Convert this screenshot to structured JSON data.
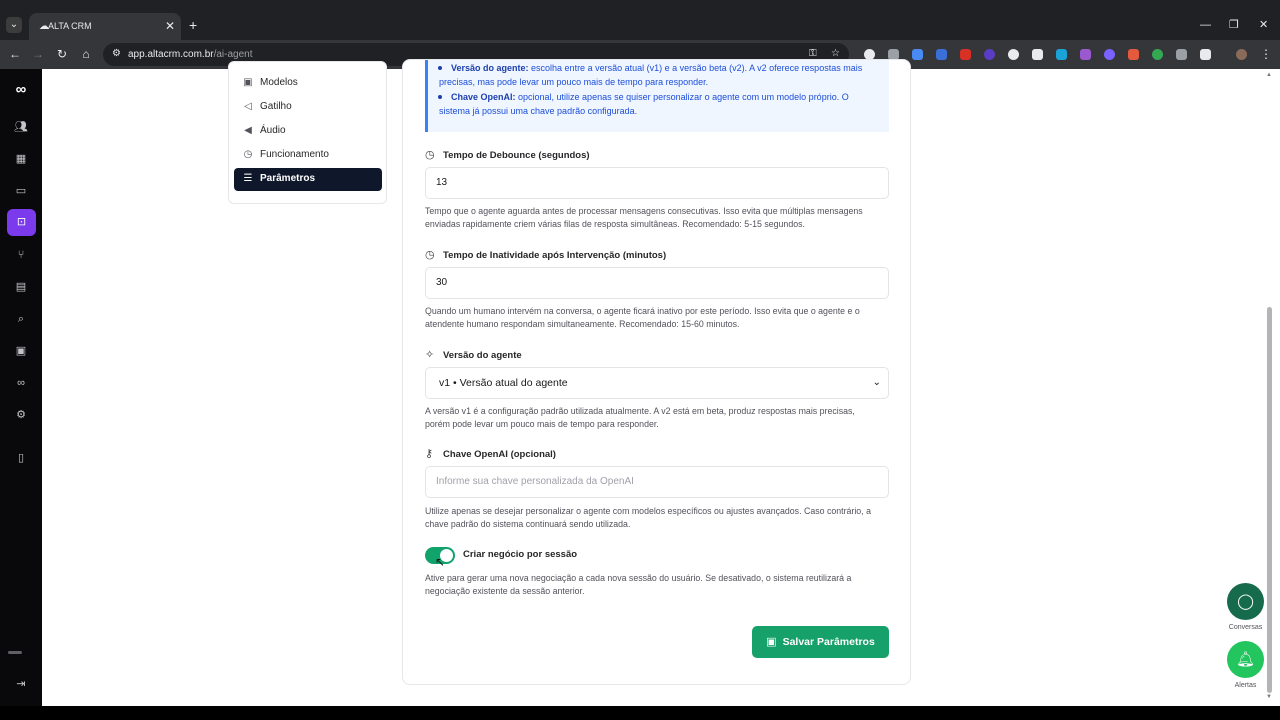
{
  "browser": {
    "tab_title": "ALTA CRM",
    "tab_close": "✕",
    "new_tab": "+",
    "url_host": "app.altacrm.com.br",
    "url_path": "/ai-agent",
    "window_min": "—",
    "window_max": "❐",
    "window_close": "✕"
  },
  "subnav": {
    "items": [
      {
        "label": "Modelos",
        "icon": "cube-icon"
      },
      {
        "label": "Gatilho",
        "icon": "megaphone-icon"
      },
      {
        "label": "Áudio",
        "icon": "speaker-icon"
      },
      {
        "label": "Funcionamento",
        "icon": "clock-icon"
      },
      {
        "label": "Parâmetros",
        "icon": "sliders-icon",
        "active": true
      }
    ]
  },
  "info": {
    "line1_bold": "Versão do agente:",
    "line1_rest": " escolha entre a versão atual (v1) e a versão beta (v2). A v2 oferece respostas mais",
    "line2": "precisas, mas pode levar um pouco mais de tempo para responder.",
    "line3_bold": "Chave OpenAI:",
    "line3_rest": " opcional, utilize apenas se quiser personalizar o agente com um modelo próprio. O",
    "line4": "sistema já possui uma chave padrão configurada."
  },
  "fields": {
    "debounce": {
      "label": "Tempo de Debounce (segundos)",
      "value": "13",
      "help1": "Tempo que o agente aguarda antes de processar mensagens consecutivas. Isso evita que múltiplas mensagens",
      "help2": "enviadas rapidamente criem várias filas de resposta simultâneas. Recomendado: 5-15 segundos."
    },
    "inactivity": {
      "label": "Tempo de Inatividade após Intervenção (minutos)",
      "value": "30",
      "help1": "Quando um humano intervém na conversa, o agente ficará inativo por este período. Isso evita que o agente e o",
      "help2": "atendente humano respondam simultaneamente. Recomendado: 15-60 minutos."
    },
    "version": {
      "label": "Versão do agente",
      "value": "v1 • Versão atual do agente",
      "help1": "A versão v1 é a configuração padrão utilizada atualmente. A v2 está em beta, produz respostas mais precisas,",
      "help2": "porém pode levar um pouco mais de tempo para responder."
    },
    "openai_key": {
      "label": "Chave OpenAI (opcional)",
      "placeholder": "Informe sua chave personalizada da OpenAI",
      "help1": "Utilize apenas se desejar personalizar o agente com modelos específicos ou ajustes avançados. Caso contrário, a",
      "help2": "chave padrão do sistema continuará sendo utilizada."
    },
    "session_deal": {
      "label": "Criar negócio por sessão",
      "enabled": true,
      "help1": "Ative para gerar uma nova negociação a cada nova sessão do usuário. Se desativado, o sistema reutilizará a",
      "help2": "negociação existente da sessão anterior."
    }
  },
  "save_button": "Salvar Parâmetros",
  "fabs": {
    "chat_label": "Conversas",
    "alerts_label": "Alertas"
  },
  "colors": {
    "accent_green": "#16a06a",
    "rail_active": "#7c3aed",
    "nav_active": "#0f172a",
    "info_border": "#3b82f6"
  }
}
